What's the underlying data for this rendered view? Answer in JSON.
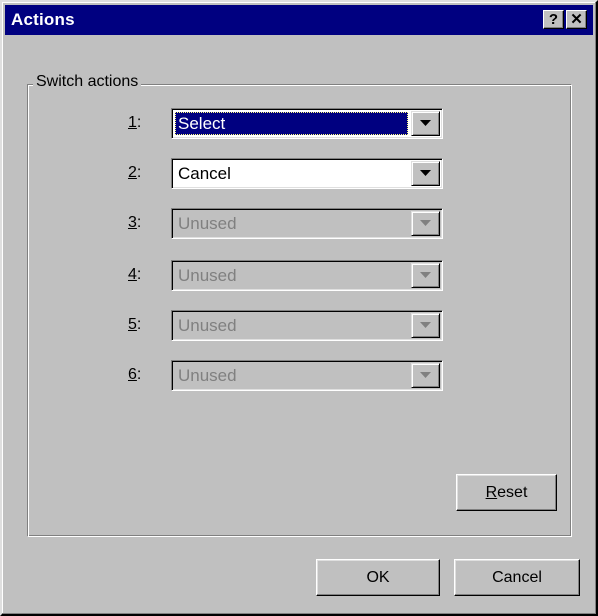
{
  "window": {
    "title": "Actions",
    "help_button": "?",
    "close_button": "✕"
  },
  "group": {
    "label": "Switch actions"
  },
  "actions": [
    {
      "number": "1",
      "suffix": ":",
      "value": "Select",
      "state": "focused"
    },
    {
      "number": "2",
      "suffix": ":",
      "value": "Cancel",
      "state": "enabled"
    },
    {
      "number": "3",
      "suffix": ":",
      "value": "Unused",
      "state": "disabled"
    },
    {
      "number": "4",
      "suffix": ":",
      "value": "Unused",
      "state": "disabled"
    },
    {
      "number": "5",
      "suffix": ":",
      "value": "Unused",
      "state": "disabled"
    },
    {
      "number": "6",
      "suffix": ":",
      "value": "Unused",
      "state": "disabled"
    }
  ],
  "buttons": {
    "reset_mnemonic": "R",
    "reset_rest": "eset",
    "ok": "OK",
    "cancel": "Cancel"
  },
  "icons": {
    "dropdown": "chevron-down-icon",
    "help": "help-icon",
    "close": "close-icon"
  },
  "colors": {
    "titlebar": "#000080",
    "face": "#c0c0c0",
    "selection": "#000080",
    "disabled_text": "#808080"
  }
}
